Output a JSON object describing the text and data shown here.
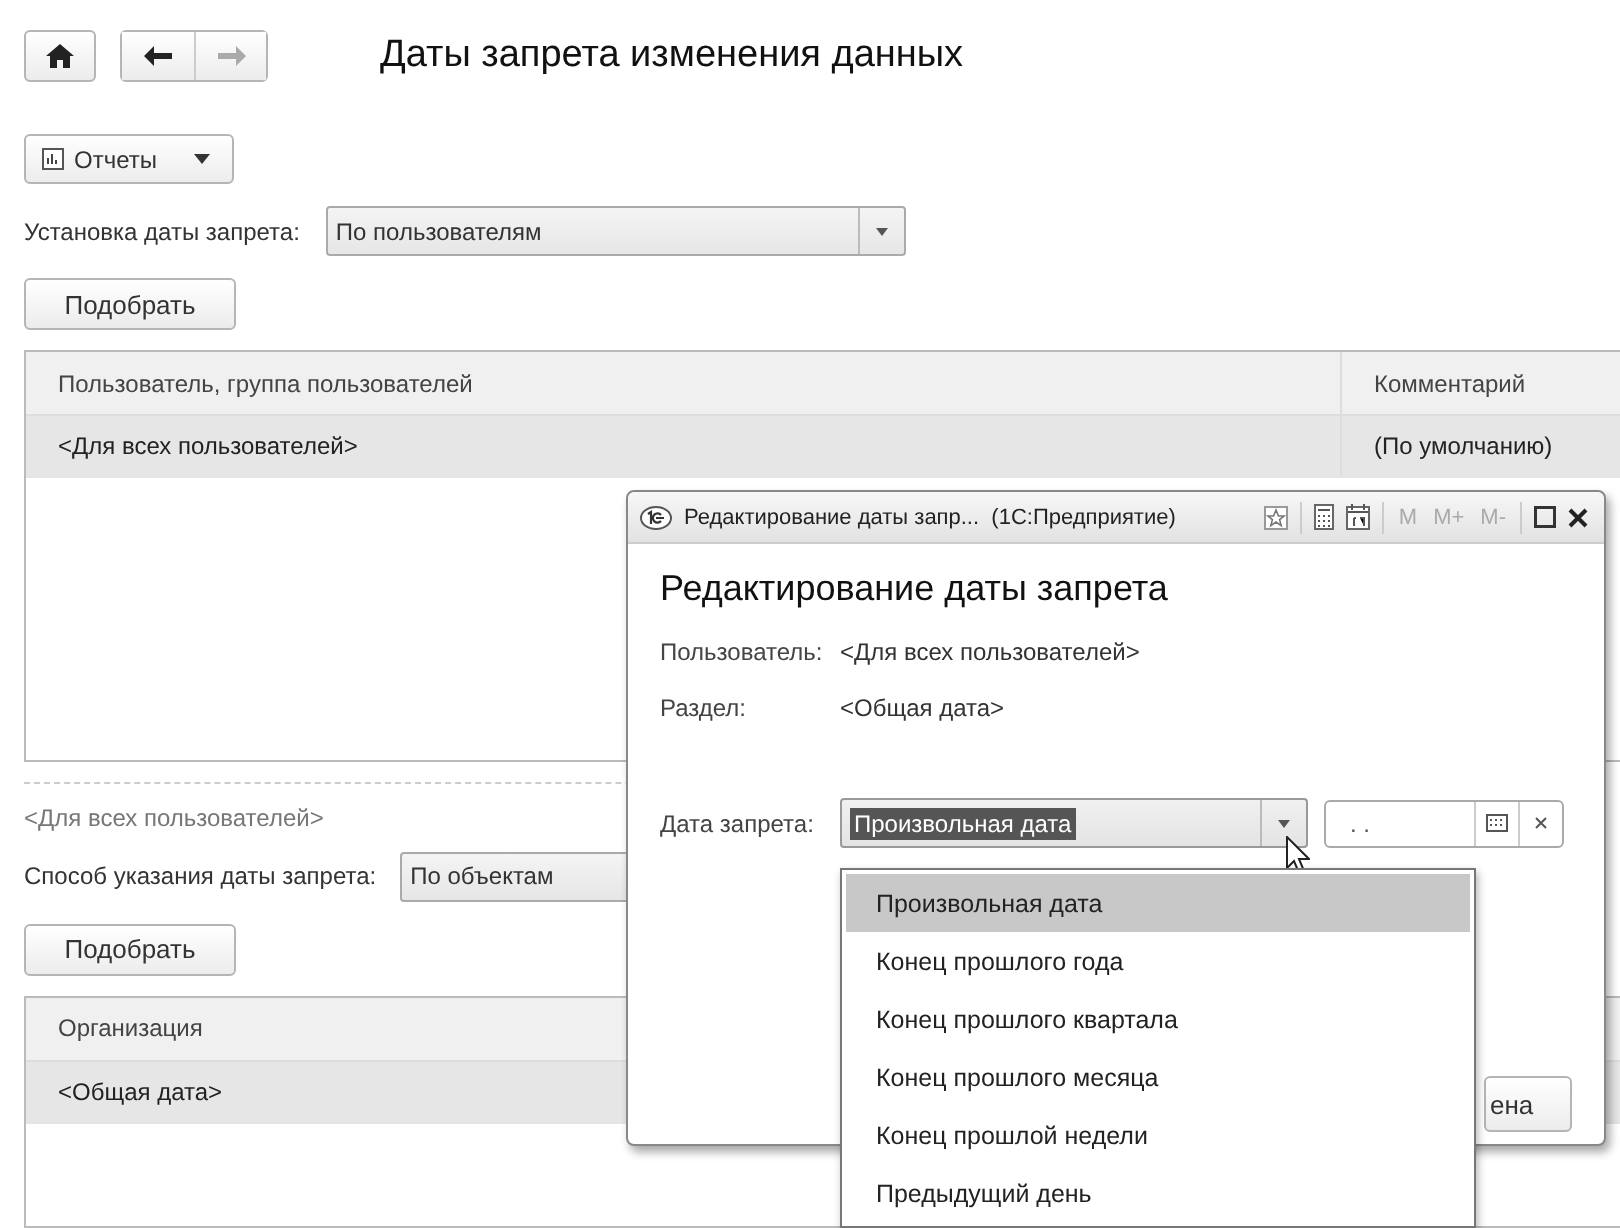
{
  "title": "Даты запрета изменения данных",
  "reports_button": {
    "label": "Отчеты"
  },
  "setting": {
    "label": "Установка даты запрета:",
    "value": "По пользователям"
  },
  "pick_button_1": "Подобрать",
  "users_table": {
    "columns": [
      "Пользователь, группа пользователей",
      "Комментарий"
    ],
    "rows": [
      {
        "cells": [
          "<Для всех пользователей>",
          "(По умолчанию)"
        ],
        "selected": true
      }
    ]
  },
  "current_user": "<Для всех пользователей>",
  "method": {
    "label": "Способ указания даты запрета:",
    "value": "По объектам"
  },
  "pick_button_2": "Подобрать",
  "sections_table": {
    "columns": [
      "Организация"
    ],
    "rows": [
      {
        "cells": [
          "<Общая дата>"
        ],
        "selected": true
      }
    ]
  },
  "dialog": {
    "window_title": "Редактирование даты запр...  (1С:Предприятие)",
    "memory_buttons": [
      "M",
      "M+",
      "M-"
    ],
    "heading": "Редактирование даты запрета",
    "fields": [
      {
        "label": "Пользователь:",
        "value": "<Для всех пользователей>"
      },
      {
        "label": "Раздел:",
        "value": "<Общая дата>"
      }
    ],
    "date_label": "Дата запрета:",
    "date_kind": {
      "value": "Произвольная дата",
      "text_selected": true
    },
    "date_field": {
      "value": ". ."
    },
    "button_partial": "ена",
    "dropdown": [
      {
        "label": "Произвольная дата",
        "selected": true
      },
      {
        "label": "Конец прошлого года",
        "selected": false
      },
      {
        "label": "Конец прошлого квартала",
        "selected": false
      },
      {
        "label": "Конец прошлого месяца",
        "selected": false
      },
      {
        "label": "Конец прошлой недели",
        "selected": false
      },
      {
        "label": "Предыдущий день",
        "selected": false
      }
    ]
  }
}
